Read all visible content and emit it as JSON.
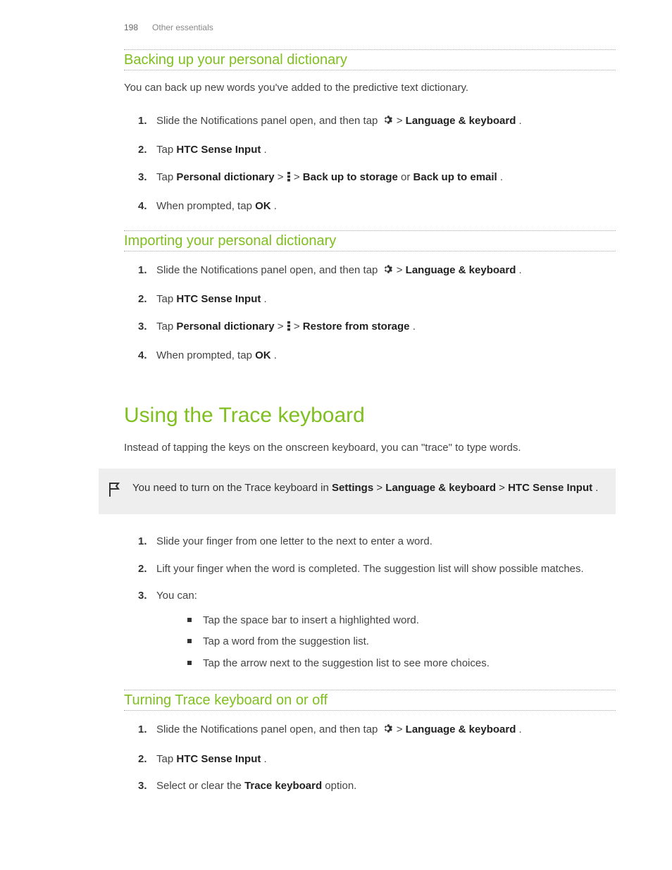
{
  "header": {
    "page_num": "198",
    "chapter": "Other essentials"
  },
  "sections": {
    "backing_up": {
      "title": "Backing up your personal dictionary",
      "intro": "You can back up new words you've added to the predictive text dictionary.",
      "steps": {
        "s1_a": "Slide the Notifications panel open, and then tap ",
        "s1_b": " > ",
        "s1_c": "Language & keyboard",
        "s1_d": ".",
        "s2_a": "Tap ",
        "s2_b": "HTC Sense Input",
        "s2_c": ".",
        "s3_a": "Tap ",
        "s3_b": "Personal dictionary",
        "s3_c": " > ",
        "s3_d": " > ",
        "s3_e": "Back up to storage",
        "s3_f": " or ",
        "s3_g": "Back up to email",
        "s3_h": ".",
        "s4_a": "When prompted, tap ",
        "s4_b": "OK",
        "s4_c": "."
      }
    },
    "importing": {
      "title": "Importing your personal dictionary",
      "steps": {
        "s1_a": "Slide the Notifications panel open, and then tap ",
        "s1_b": " > ",
        "s1_c": "Language & keyboard",
        "s1_d": ".",
        "s2_a": "Tap ",
        "s2_b": "HTC Sense Input",
        "s2_c": ".",
        "s3_a": "Tap ",
        "s3_b": "Personal dictionary",
        "s3_c": " > ",
        "s3_d": " > ",
        "s3_e": "Restore from storage",
        "s3_f": ".",
        "s4_a": "When prompted, tap ",
        "s4_b": "OK",
        "s4_c": "."
      }
    },
    "trace": {
      "title": "Using the Trace keyboard",
      "intro": "Instead of tapping the keys on the onscreen keyboard, you can \"trace\" to type words.",
      "callout_a": "You need to turn on the Trace keyboard in ",
      "callout_b": "Settings",
      "callout_c": " > ",
      "callout_d": "Language & keyboard",
      "callout_e": " > ",
      "callout_f": "HTC Sense Input",
      "callout_g": ".",
      "steps": {
        "s1": "Slide your finger from one letter to the next to enter a word.",
        "s2": "Lift your finger when the word is completed. The suggestion list will show possible matches.",
        "s3": "You can:",
        "b1": "Tap the space bar to insert a highlighted word.",
        "b2": "Tap a word from the suggestion list.",
        "b3": "Tap the arrow next to the suggestion list to see more choices."
      }
    },
    "turning": {
      "title": "Turning Trace keyboard on or off",
      "steps": {
        "s1_a": "Slide the Notifications panel open, and then tap ",
        "s1_b": " > ",
        "s1_c": "Language & keyboard",
        "s1_d": ".",
        "s2_a": "Tap ",
        "s2_b": "HTC Sense Input",
        "s2_c": ".",
        "s3_a": "Select or clear the ",
        "s3_b": "Trace keyboard",
        "s3_c": " option."
      }
    }
  }
}
